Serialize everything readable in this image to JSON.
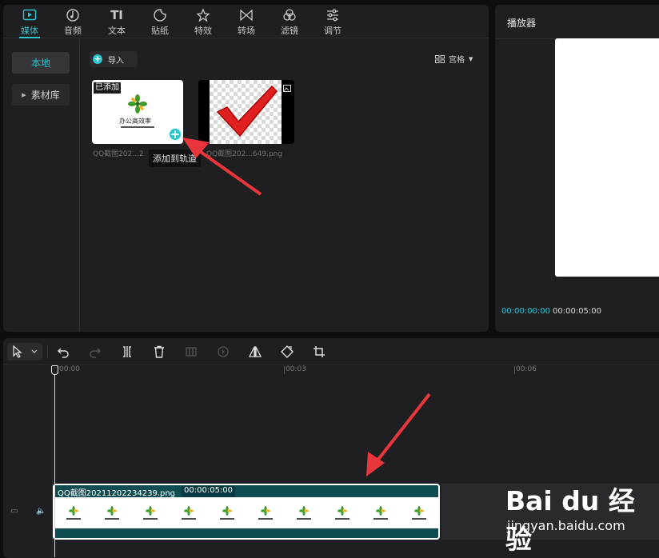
{
  "tabs": [
    {
      "label": "媒体",
      "icon": "media-icon",
      "active": true
    },
    {
      "label": "音频",
      "icon": "audio-icon",
      "active": false
    },
    {
      "label": "文本",
      "icon": "text-icon",
      "active": false
    },
    {
      "label": "贴纸",
      "icon": "sticker-icon",
      "active": false
    },
    {
      "label": "特效",
      "icon": "effects-icon",
      "active": false
    },
    {
      "label": "转场",
      "icon": "transition-icon",
      "active": false
    },
    {
      "label": "滤镜",
      "icon": "filter-icon",
      "active": false
    },
    {
      "label": "调节",
      "icon": "adjust-icon",
      "active": false
    }
  ],
  "sidebar": {
    "local": "本地",
    "library": "素材库"
  },
  "media": {
    "import_label": "导入",
    "view_label": "宫格",
    "items": [
      {
        "name": "QQ截图202...2",
        "badge": "已添加",
        "thumb_text": "办公高效率"
      },
      {
        "name": "QQ截图202...649.png"
      }
    ],
    "tooltip": "添加到轨道"
  },
  "player": {
    "title": "播放器",
    "current_time": "00:00:00:00",
    "total_time": "00:00:05:00"
  },
  "timeline": {
    "ruler": [
      "00:00",
      "00:03",
      "00:06"
    ],
    "clip": {
      "name": "QQ截图20211202234239.png",
      "duration": "00:00:05:00"
    }
  },
  "watermark": {
    "main": "Bai du 经验",
    "sub": "jingyan.baidu.com"
  },
  "colors": {
    "accent": "#2bc4cf",
    "annotation": "#e8363a",
    "clip": "#0f4d53"
  }
}
